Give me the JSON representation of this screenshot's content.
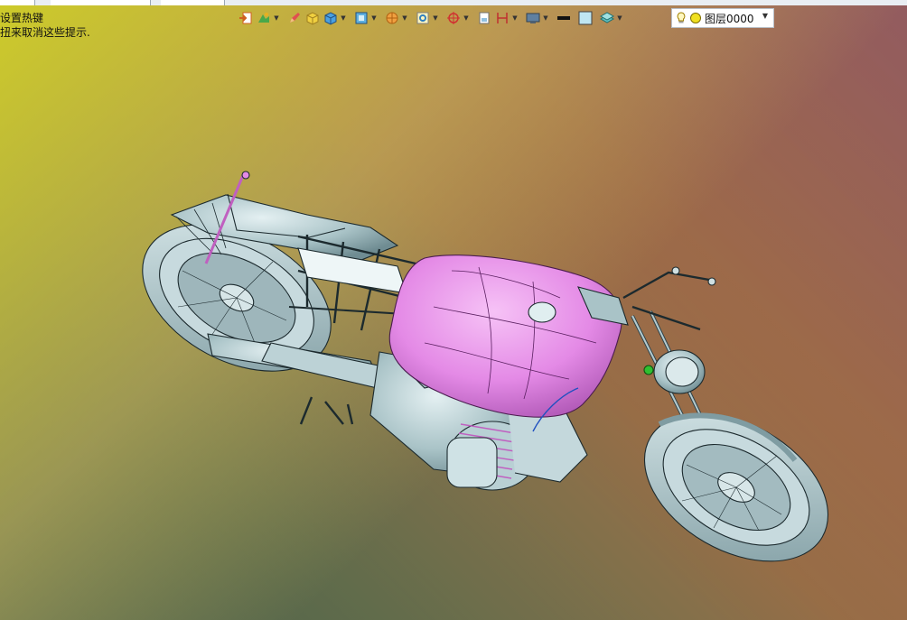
{
  "hints": {
    "line1": "设置热键",
    "line2": "扭来取消这些提示."
  },
  "toolbar": {
    "icons": [
      "exit-sketch-icon",
      "sketch-tools-icon",
      "pencil-icon",
      "solid-box-icon",
      "cube-icon",
      "view-cube-icon",
      "render-mode-icon",
      "zoom-fit-icon",
      "snap-target-icon",
      "page-icon",
      "dimension-icon",
      "display-icon",
      "line-color-swatch",
      "fill-color-swatch",
      "layer-stack-icon"
    ],
    "line_color": "#111111",
    "fill_color": "#bfe6f2"
  },
  "layer_selector": {
    "value": "图层0000"
  },
  "colors": {
    "tank": "#e58ae6",
    "body": "#aac4c8",
    "accent": "#c868c8"
  }
}
